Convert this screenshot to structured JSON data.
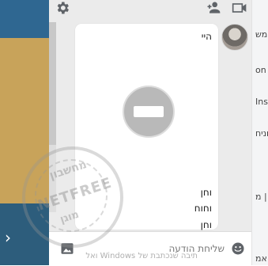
{
  "chat": {
    "messages": [
      "היי",
      "וחן",
      "וחוח",
      "וחן"
    ],
    "composer_placeholder": "שליחת הודעה",
    "under_text": "תיבה שנכתבת של Windows ואל"
  },
  "watermark": {
    "top": "מחשבון",
    "middle": "NETFREE",
    "bottom": "מוגן"
  },
  "right_strip": {
    "items": [
      "אמש",
      "on F",
      "Ins",
      "וניח",
      "| מ",
      "אמ"
    ]
  },
  "colors": {
    "left_blue": "#2f6791",
    "left_gold": "#c8a35a",
    "left_teal": "#2d5d7c",
    "chat_bg": "#ebebeb",
    "bubble_bg": "#ffffff",
    "blocked_grey": "#b9b9b9"
  },
  "icons": {
    "gear": "gear-icon",
    "add_user": "add-user-icon",
    "video": "video-call-icon",
    "blocked": "blocked-content-icon",
    "image": "image-icon",
    "emoji": "emoji-icon",
    "chevron": "chevron-right-icon"
  }
}
